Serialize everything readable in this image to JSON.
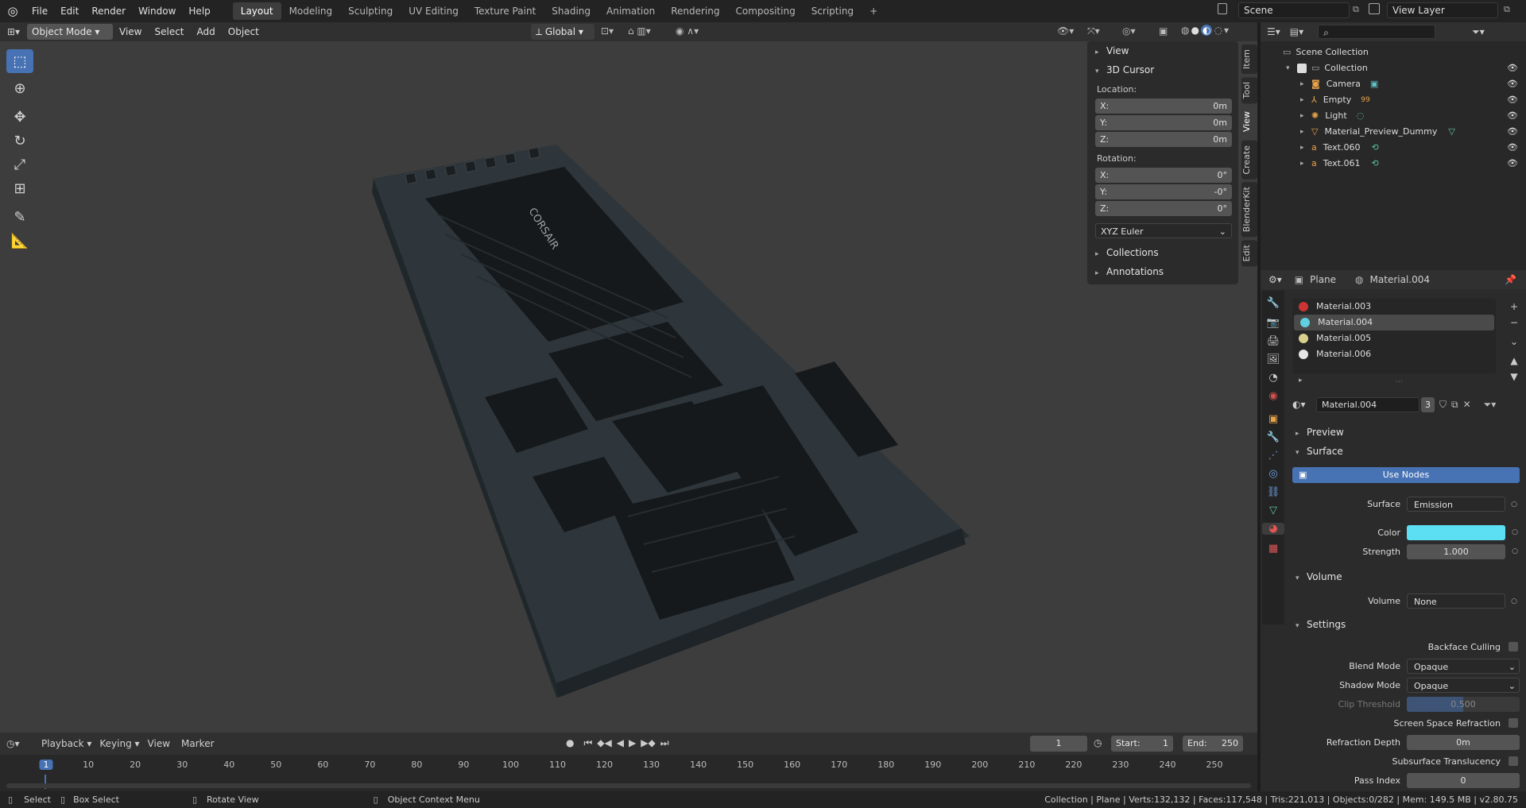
{
  "topbar": {
    "menus": [
      "File",
      "Edit",
      "Render",
      "Window",
      "Help"
    ],
    "workspaces": [
      "Layout",
      "Modeling",
      "Sculpting",
      "UV Editing",
      "Texture Paint",
      "Shading",
      "Animation",
      "Rendering",
      "Compositing",
      "Scripting"
    ],
    "active_workspace": "Layout",
    "add_tab": "+",
    "scene": "Scene",
    "view_layer": "View Layer"
  },
  "viewport_header": {
    "mode": "Object Mode",
    "menus": [
      "View",
      "Select",
      "Add",
      "Object"
    ],
    "transform_orientation": "Global"
  },
  "toolbar": {
    "tools": [
      "select-box",
      "cursor",
      "move",
      "rotate",
      "scale",
      "transform",
      "annotate",
      "measure"
    ],
    "active": "select-box"
  },
  "npanel": {
    "view": "View",
    "cursor": "3D Cursor",
    "location_label": "Location:",
    "location": [
      {
        "axis": "X:",
        "value": "0m"
      },
      {
        "axis": "Y:",
        "value": "0m"
      },
      {
        "axis": "Z:",
        "value": "0m"
      }
    ],
    "rotation_label": "Rotation:",
    "rotation": [
      {
        "axis": "X:",
        "value": "0°"
      },
      {
        "axis": "Y:",
        "value": "-0°"
      },
      {
        "axis": "Z:",
        "value": "0°"
      }
    ],
    "rotation_mode": "XYZ Euler",
    "collections": "Collections",
    "annotations": "Annotations",
    "tabs": [
      "Item",
      "Tool",
      "View",
      "Create",
      "BlenderKit",
      "Edit"
    ],
    "active_tab": "View"
  },
  "keyboard": {
    "brand": "CORSAIR",
    "color": "#2b3339"
  },
  "outliner": {
    "root": "Scene Collection",
    "collection": "Collection",
    "objects": [
      {
        "name": "Camera",
        "icon_color": "#e8a34a",
        "extra": ""
      },
      {
        "name": "Empty",
        "icon_color": "#e8a34a",
        "extra": "99"
      },
      {
        "name": "Light",
        "icon_color": "#e8a34a",
        "extra": ""
      },
      {
        "name": "Material_Preview_Dummy",
        "icon_color": "#e8a34a",
        "extra": ""
      },
      {
        "name": "Text.060",
        "icon_color": "#e8a34a",
        "extra": ""
      },
      {
        "name": "Text.061",
        "icon_color": "#e8a34a",
        "extra": ""
      }
    ]
  },
  "properties": {
    "object": "Plane",
    "material": "Material.004",
    "slots": [
      {
        "name": "Material.003",
        "color": "#cc3333"
      },
      {
        "name": "Material.004",
        "color": "#5fd0e0"
      },
      {
        "name": "Material.005",
        "color": "#d8d08c"
      },
      {
        "name": "Material.006",
        "color": "#e6e6e6"
      }
    ],
    "active_slot": 1,
    "material_field": "Material.004",
    "users": "3",
    "preview": "Preview",
    "surface_section": "Surface",
    "use_nodes": "Use Nodes",
    "surface_label": "Surface",
    "surface_value": "Emission",
    "color_label": "Color",
    "color_value": "#5ddff3",
    "strength_label": "Strength",
    "strength_value": "1.000",
    "volume_section": "Volume",
    "volume_label": "Volume",
    "volume_value": "None",
    "settings_section": "Settings",
    "backface_label": "Backface Culling",
    "blend_label": "Blend Mode",
    "blend_value": "Opaque",
    "shadow_label": "Shadow Mode",
    "shadow_value": "Opaque",
    "clip_label": "Clip Threshold",
    "clip_value": "0.500",
    "clip_fraction": 0.5,
    "ssr_label": "Screen Space Refraction",
    "refr_depth_label": "Refraction Depth",
    "refr_depth_value": "0m",
    "sss_label": "Subsurface Translucency",
    "pass_label": "Pass Index",
    "pass_value": "0"
  },
  "timeline": {
    "menus": [
      "Playback",
      "Keying",
      "View",
      "Marker"
    ],
    "current_frame": "1",
    "start_label": "Start:",
    "start": "1",
    "end_label": "End:",
    "end": "250",
    "ruler": [
      "1",
      "10",
      "20",
      "30",
      "40",
      "50",
      "60",
      "70",
      "80",
      "90",
      "100",
      "110",
      "120",
      "130",
      "140",
      "150",
      "160",
      "170",
      "180",
      "190",
      "200",
      "210",
      "220",
      "230",
      "240",
      "250"
    ]
  },
  "statusbar": {
    "select": "Select",
    "box_select": "Box Select",
    "rotate_view": "Rotate View",
    "context_menu": "Object Context Menu",
    "stats": "Collection | Plane | Verts:132,132 | Faces:117,548 | Tris:221,013 | Objects:0/282 | Mem: 149.5 MB | v2.80.75"
  }
}
